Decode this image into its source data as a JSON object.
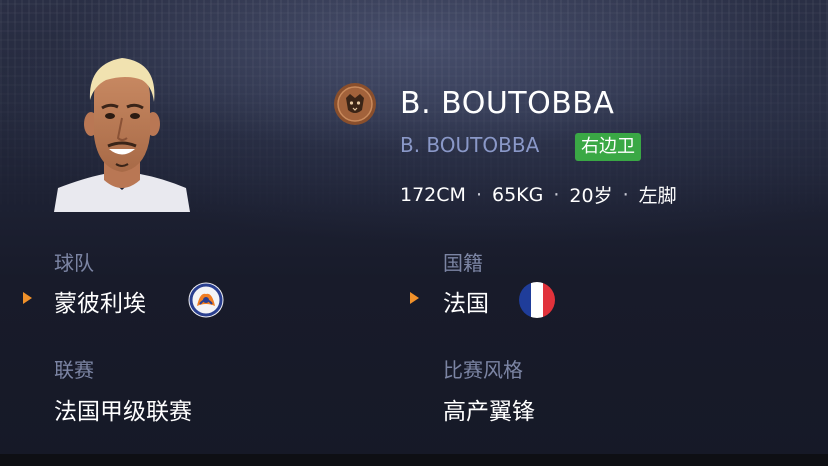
{
  "player": {
    "name": "B. BOUTOBBA",
    "short_name": "B. BOUTOBBA",
    "position": "右边卫",
    "height": "172CM",
    "weight": "65KG",
    "age": "20岁",
    "foot": "左脚"
  },
  "separator": "·",
  "fields": {
    "team_label": "球队",
    "team_value": "蒙彼利埃",
    "nationality_label": "国籍",
    "nationality_value": "法国",
    "league_label": "联赛",
    "league_value": "法国甲级联赛",
    "style_label": "比赛风格",
    "style_value": "高产翼锋"
  },
  "icons": {
    "club_crest": "montpellier-crest-icon",
    "coin_crest": "club-coin-icon",
    "flag": "france-flag-icon",
    "arrow": "orange-arrow-icon"
  },
  "colors": {
    "accent_arrow": "#f0912a",
    "position_badge": "#3aa845",
    "sub_name": "#8a98c8",
    "label": "#7c85a4"
  }
}
